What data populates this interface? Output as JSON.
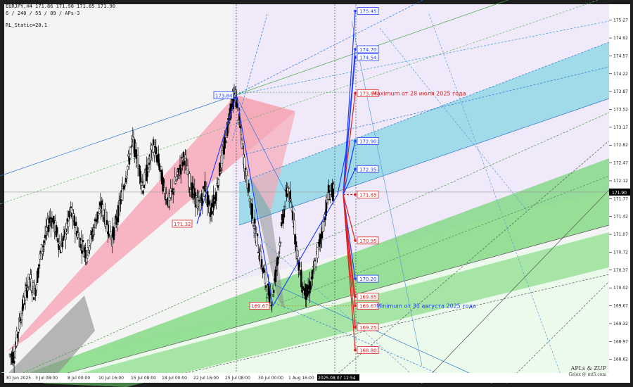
{
  "header": {
    "symbol_line": "EURJPY,H4  171.86 171.98 171.85 171.90",
    "indicator_line": "6 / 240 / 55 / 89 / APs-3",
    "static_line": "RL_Static=28.1"
  },
  "watermark": {
    "line1": "APLs & ZUP",
    "line2": "Gelox @ mt5.com"
  },
  "colors": {
    "bull": "#000000",
    "bear": "#000000",
    "pink_band": "#f7a8b8",
    "cyan_band": "#7fd3df",
    "green_band": "#6fd46f",
    "blue_line": "#1e3cff",
    "red_line": "#e02020",
    "lavender": "#efe8fb",
    "mint": "#eafbe8"
  },
  "chart_data": {
    "type": "candlestick",
    "symbol": "EURJPY",
    "timeframe": "H4",
    "ylim": [
      168.27,
      175.5
    ],
    "y_ticks": [
      "175.27",
      "174.92",
      "174.57",
      "174.22",
      "173.87",
      "173.52",
      "173.17",
      "172.82",
      "172.47",
      "172.12",
      "171.77",
      "171.42",
      "171.07",
      "170.72",
      "170.37",
      "170.02",
      "169.67",
      "169.32",
      "168.97",
      "168.62",
      "168.27"
    ],
    "x_ticks": [
      "30 Jun 2025",
      "3 Jul 08:00",
      "8 Jul 00:00",
      "10 Jul 16:00",
      "15 Jul 08:00",
      "18 Jul 00:00",
      "22 Jul 16:00",
      "25 Jul 08:00",
      "30 Jul 00:00",
      "1 Aug 16:00",
      "2025.08.07 12:54"
    ],
    "current_price": "171.90",
    "price_labels": [
      {
        "value": "175.45",
        "color": "blue"
      },
      {
        "value": "174.70",
        "color": "blue"
      },
      {
        "value": "174.54",
        "color": "blue"
      },
      {
        "value": "173.84",
        "color": "red"
      },
      {
        "value": "172.90",
        "color": "blue"
      },
      {
        "value": "172.35",
        "color": "blue"
      },
      {
        "value": "171.85",
        "color": "red"
      },
      {
        "value": "170.95",
        "color": "red"
      },
      {
        "value": "170.20",
        "color": "blue"
      },
      {
        "value": "169.85",
        "color": "red"
      },
      {
        "value": "169.67",
        "color": "red"
      },
      {
        "value": "169.25",
        "color": "red"
      },
      {
        "value": "168.80",
        "color": "red"
      }
    ],
    "pivot_labels": [
      {
        "value": "173.84",
        "color": "blue"
      },
      {
        "value": "171.32",
        "color": "red"
      },
      {
        "value": "169.67",
        "color": "red"
      }
    ],
    "annotations": {
      "max_text": "Maximum от 28 июля 2025 года",
      "min_text": "Minimum от 31 августа 2025 года"
    },
    "path_close": [
      168.7,
      169.3,
      169.8,
      170.2,
      169.9,
      170.6,
      171.0,
      171.4,
      171.2,
      170.8,
      171.1,
      171.5,
      171.2,
      170.9,
      170.7,
      171.0,
      171.4,
      171.6,
      171.3,
      171.0,
      171.4,
      171.9,
      172.4,
      172.9,
      172.5,
      172.0,
      172.4,
      172.8,
      172.5,
      172.0,
      171.7,
      172.0,
      172.3,
      172.6,
      172.1,
      171.8,
      171.6,
      172.0,
      171.5,
      171.8,
      172.4,
      172.9,
      173.6,
      173.8,
      173.0,
      172.2,
      171.6,
      171.0,
      170.5,
      170.0,
      169.8,
      170.5,
      171.3,
      172.0,
      171.5,
      170.6,
      170.0,
      169.9,
      170.3,
      170.8,
      171.3,
      171.9,
      171.9
    ]
  }
}
